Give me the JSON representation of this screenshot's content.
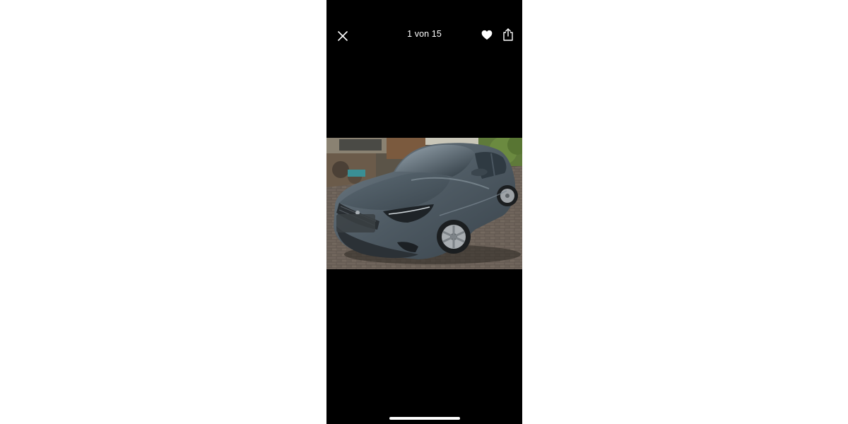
{
  "header": {
    "counter_text": "1 von 15"
  },
  "icons": {
    "close": "close-icon",
    "favorite": "heart-icon",
    "share": "share-icon"
  },
  "photo": {
    "subject": "car-photo"
  },
  "colors": {
    "viewer_background": "#000000",
    "page_background": "#ffffff",
    "icon_color": "#ffffff"
  }
}
